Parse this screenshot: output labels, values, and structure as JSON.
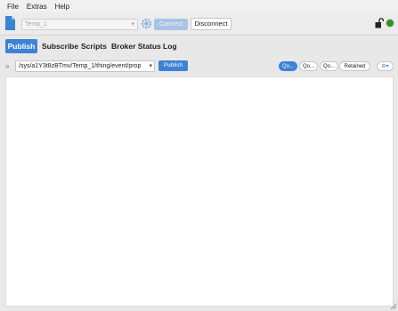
{
  "menubar": {
    "items": [
      "File",
      "Extras",
      "Help"
    ]
  },
  "toolbar": {
    "profile_value": "Temp_1",
    "connect_label": "Connect",
    "disconnect_label": "Disconnect",
    "icons": {
      "document": "document-icon",
      "settings": "gear-icon",
      "lock": "unlocked-lock-icon",
      "status": "connection-status-dot"
    },
    "status_color": "#3a8a2a"
  },
  "tabs": [
    "Publish",
    "Subscribe",
    "Scripts",
    "Broker Status",
    "Log"
  ],
  "active_tab": "Publish",
  "publish": {
    "topic": "/sys/a1Y3t8zBTmv/Temp_1/thing/event/prop",
    "publish_label": "Publish",
    "qos": [
      "Qo...",
      "Qo...",
      "Qo..."
    ],
    "retained_label": "Retained",
    "payload": ""
  },
  "colors": {
    "accent": "#3b83d6"
  }
}
